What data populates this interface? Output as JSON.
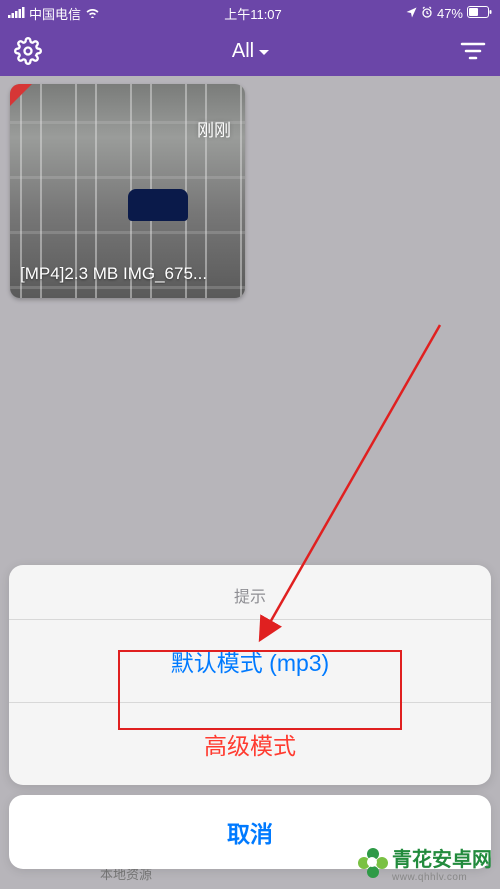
{
  "status_bar": {
    "carrier": "中国电信",
    "time": "上午11:07",
    "battery_text": "47%"
  },
  "navbar": {
    "title": "All"
  },
  "grid": {
    "items": [
      {
        "timestamp": "刚刚",
        "file_label": "[MP4]2.3 MB IMG_675..."
      }
    ]
  },
  "action_sheet": {
    "title": "提示",
    "default_mode": "默认模式 (mp3)",
    "advanced_mode": "高级模式",
    "cancel": "取消"
  },
  "obscured_text": "本地资源",
  "watermark": {
    "brand": "青花安卓网",
    "url": "www.qhhlv.com"
  },
  "colors": {
    "primary": "#6b46a8",
    "ios_blue": "#007aff",
    "ios_red": "#ff3b30",
    "annot_red": "#e02020"
  }
}
